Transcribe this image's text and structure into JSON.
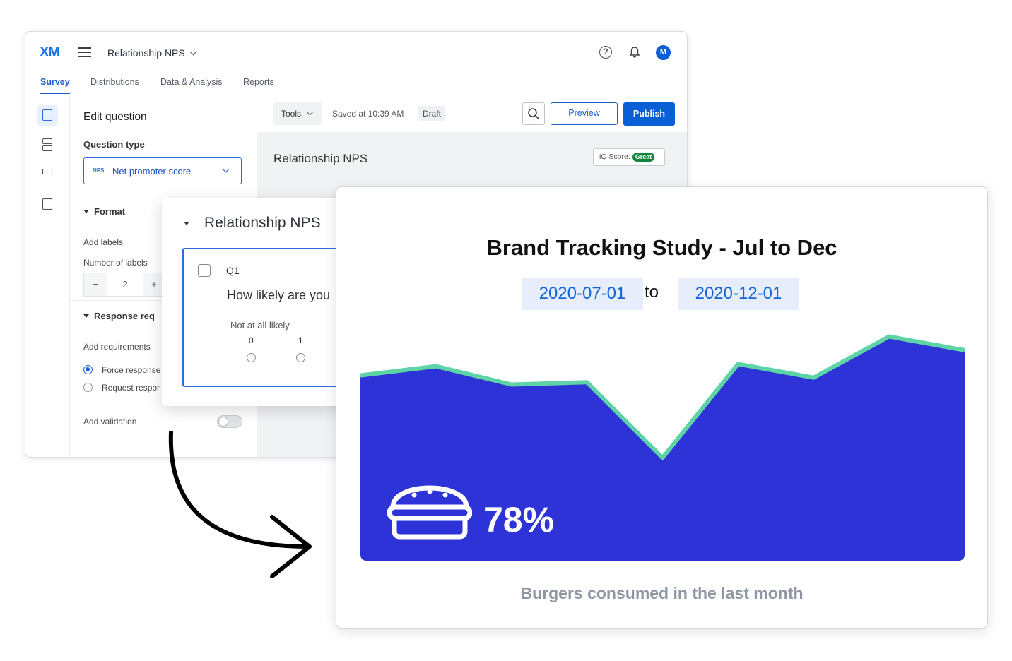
{
  "survey_editor": {
    "logo": "XM",
    "project_name": "Relationship NPS",
    "avatar_initial": "M",
    "help_glyph": "?",
    "tabs": [
      "Survey",
      "Distributions",
      "Data & Analysis",
      "Reports"
    ],
    "active_tab": "Survey",
    "edit_panel": {
      "title": "Edit question",
      "question_type_label": "Question type",
      "question_type_badge": "NPS",
      "question_type_value": "Net promoter score",
      "format_label": "Format",
      "add_labels": "Add labels",
      "number_of_labels_label": "Number of labels",
      "number_of_labels_value": "2",
      "stepper_minus": "−",
      "stepper_plus": "+",
      "response_req_label": "Response req",
      "add_requirements": "Add requirements",
      "force_response": "Force response",
      "request_response": "Request respor",
      "add_validation": "Add validation"
    },
    "toolbar": {
      "tools_label": "Tools",
      "saved_text": "Saved at 10:39 AM",
      "draft_label": "Draft",
      "preview_label": "Preview",
      "publish_label": "Publish"
    },
    "survey_title": "Relationship NPS",
    "iq_score_label": "iQ Score:",
    "iq_score_value": "Great"
  },
  "question_card": {
    "block_title": "Relationship NPS",
    "question_id": "Q1",
    "question_text": "How likely are you",
    "scale_anchor_low": "Not at all likely",
    "scale_numbers": [
      "0",
      "1"
    ]
  },
  "dashboard": {
    "title": "Brand Tracking Study - Jul to Dec",
    "date_from": "2020-07-01",
    "date_sep": "to",
    "date_to": "2020-12-01",
    "stat_value": "78%",
    "stat_icon": "burger-icon",
    "caption": "Burgers consumed in the last month",
    "colors": {
      "area_fill": "#2d33d6",
      "line": "#5dd3a6",
      "date_chip_bg": "#e7edfa",
      "date_text": "#1265d9",
      "caption": "#8e96a3"
    }
  },
  "chart_data": {
    "type": "area",
    "title": "Brand Tracking Study - Jul to Dec",
    "x": [
      1,
      2,
      3,
      4,
      5,
      6,
      7,
      8,
      9
    ],
    "values": [
      81,
      85,
      77,
      78,
      45,
      86,
      80,
      98,
      92
    ],
    "ylim": [
      0,
      100
    ],
    "xlabel": "",
    "ylabel": "",
    "grid": false
  }
}
